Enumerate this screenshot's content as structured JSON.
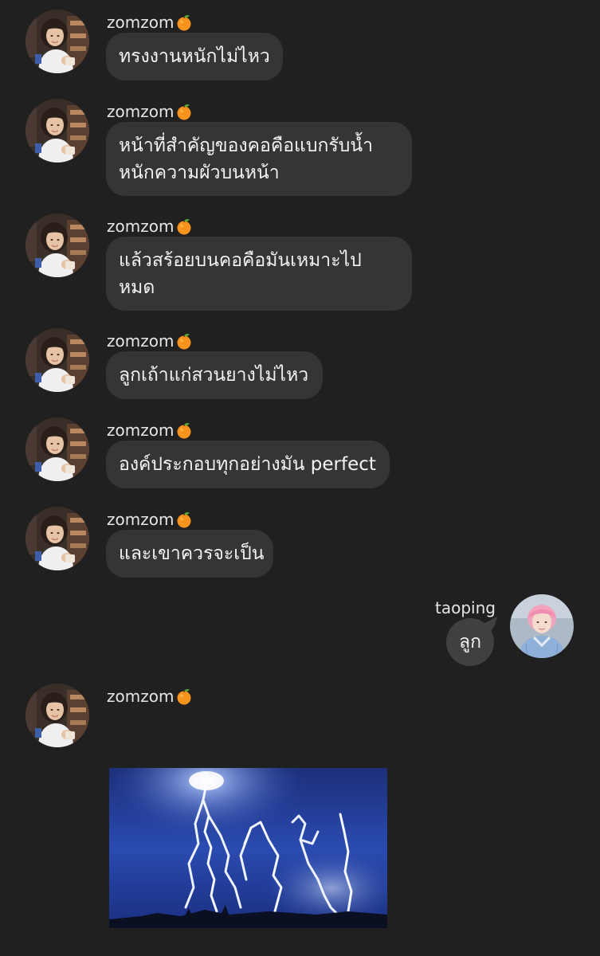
{
  "chat": {
    "messages": [
      {
        "sender": "zomzom",
        "lines": [
          "ทรงงานหนักไม่ไหว"
        ]
      },
      {
        "sender": "zomzom",
        "lines": [
          "หน้าที่สำคัญของคอคือแบกรับน้ำ",
          "หนักความผัวบนหน้า"
        ]
      },
      {
        "sender": "zomzom",
        "lines": [
          "แล้วสร้อยบนคอคือมันเหมาะไป",
          "หมด"
        ]
      },
      {
        "sender": "zomzom",
        "lines": [
          "ลูกเถ้าแก่สวนยางไม่ไหว"
        ]
      },
      {
        "sender": "zomzom",
        "lines": [
          "องค์ประกอบทุกอย่างมัน perfect"
        ]
      },
      {
        "sender": "zomzom",
        "lines": [
          "และเขาควรจะเป็น"
        ]
      },
      {
        "sender": "taoping",
        "lines": [
          "ลูก"
        ]
      },
      {
        "sender": "zomzom",
        "lines": []
      }
    ],
    "sender_emoji_icon": "orange-icon",
    "image_attachment": {
      "icon": "lightning-photo"
    }
  },
  "colors": {
    "background": "#202020",
    "incoming_bubble": "#353535",
    "outgoing_bubble": "#404040",
    "text": "#f3f3f3"
  }
}
